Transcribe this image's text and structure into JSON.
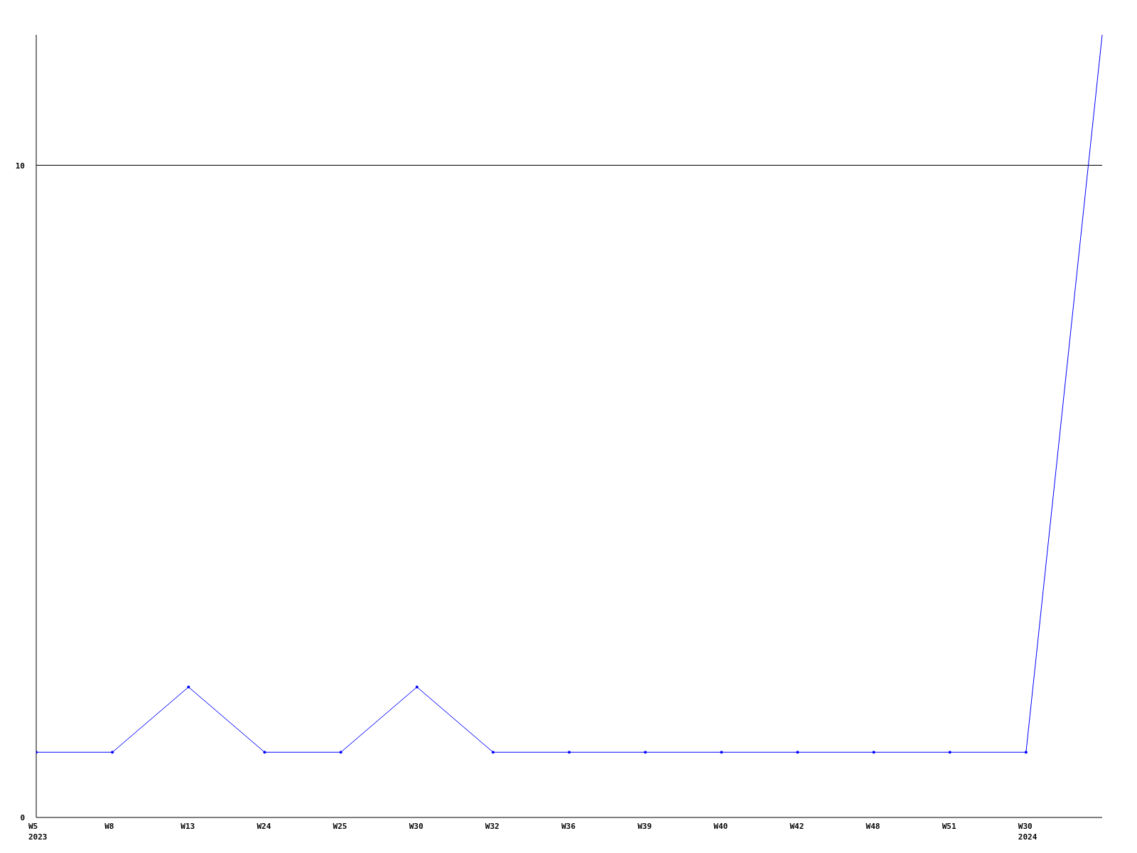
{
  "chart_data": {
    "type": "line",
    "categories": [
      "W5\n2023",
      "W8",
      "W13",
      "W24",
      "W25",
      "W30",
      "W32",
      "W36",
      "W39",
      "W40",
      "W42",
      "W48",
      "W51",
      "W30\n2024",
      null
    ],
    "series": [
      {
        "color": "#0000ff",
        "values": [
          1,
          1,
          2,
          1,
          1,
          2,
          1,
          1,
          1,
          1,
          1,
          1,
          1,
          1,
          12
        ]
      }
    ],
    "ylim": [
      0,
      12
    ],
    "yticks": [
      0,
      10
    ]
  }
}
